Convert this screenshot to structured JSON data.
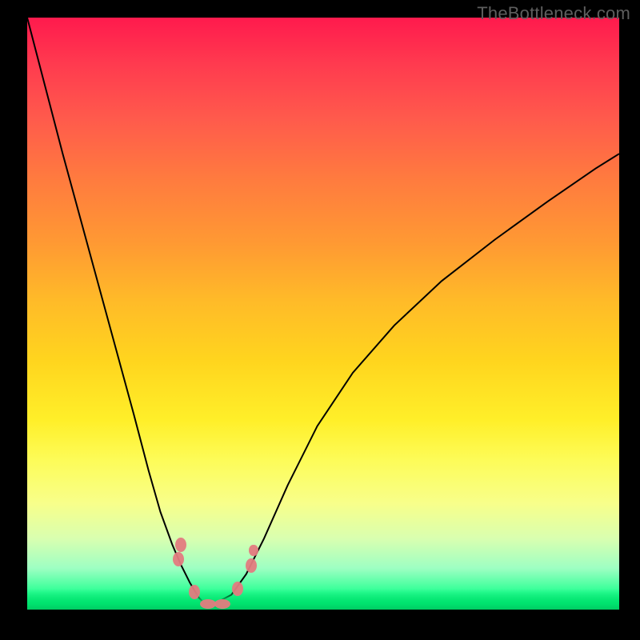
{
  "watermark": "TheBottleneck.com",
  "chart_data": {
    "type": "line",
    "title": "",
    "xlabel": "",
    "ylabel": "",
    "xlim": [
      0,
      1
    ],
    "ylim": [
      0,
      1
    ],
    "left_branch": {
      "x": [
        0.0,
        0.03,
        0.06,
        0.09,
        0.12,
        0.15,
        0.18,
        0.205,
        0.225,
        0.245,
        0.26,
        0.275,
        0.29,
        0.3
      ],
      "y": [
        1.0,
        0.885,
        0.77,
        0.66,
        0.55,
        0.44,
        0.33,
        0.235,
        0.165,
        0.11,
        0.075,
        0.045,
        0.02,
        0.01
      ]
    },
    "right_branch": {
      "x": [
        0.3,
        0.32,
        0.345,
        0.37,
        0.4,
        0.44,
        0.49,
        0.55,
        0.62,
        0.7,
        0.79,
        0.88,
        0.96,
        1.0
      ],
      "y": [
        0.01,
        0.012,
        0.025,
        0.06,
        0.12,
        0.21,
        0.31,
        0.4,
        0.48,
        0.555,
        0.625,
        0.69,
        0.745,
        0.77
      ]
    },
    "clusters": [
      {
        "x": 0.255,
        "y": 0.085,
        "size": "normal"
      },
      {
        "x": 0.26,
        "y": 0.11,
        "size": "normal"
      },
      {
        "x": 0.282,
        "y": 0.03,
        "size": "normal"
      },
      {
        "x": 0.305,
        "y": 0.01,
        "size": "wide"
      },
      {
        "x": 0.33,
        "y": 0.01,
        "size": "wide"
      },
      {
        "x": 0.355,
        "y": 0.035,
        "size": "normal"
      },
      {
        "x": 0.378,
        "y": 0.075,
        "size": "normal"
      },
      {
        "x": 0.382,
        "y": 0.1,
        "size": "small"
      }
    ],
    "legend": []
  },
  "colors": {
    "curve": "#000000",
    "marker": "#e37b7f",
    "background_frame": "#000000"
  }
}
